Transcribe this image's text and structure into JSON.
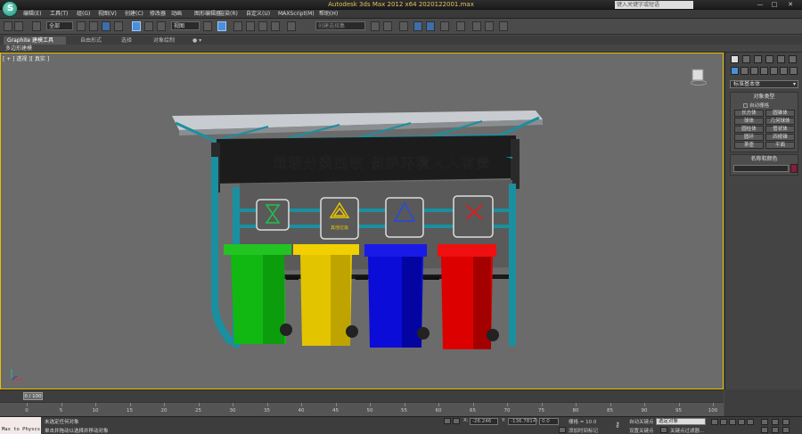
{
  "window": {
    "title": "Autodesk 3ds Max  2012 x64      20201220​01.max",
    "search_placeholder": "键入关键字或短语",
    "controls": [
      "—",
      "□",
      "✕"
    ]
  },
  "menu": [
    "编辑(E)",
    "工具(T)",
    "组(G)",
    "视图(V)",
    "创建(C)",
    "修改器",
    "动画",
    "图形编辑器",
    "渲染(R)",
    "自定义(U)",
    "MAXScript(M)",
    "帮助(H)"
  ],
  "toolbar": {
    "selection_filter": "全部",
    "reference_coord": "视图",
    "named_selection": "创建选择集"
  },
  "ribbon": {
    "tabs": [
      "Graphite 建模工具",
      "自由形式",
      "选择",
      "对象绘制"
    ],
    "active_tab": "Graphite 建模工具",
    "sub_label": "多边形建模"
  },
  "viewport": {
    "label": "[ + ] 透视 ][ 真实 ]",
    "scene": {
      "shelter_text": "垃圾分类回收  保护环境人人有责",
      "signs": [
        {
          "name": "hazardous",
          "color": "#22c24a",
          "caption": ""
        },
        {
          "name": "other",
          "color": "#e8c500",
          "caption": "其他垃圾"
        },
        {
          "name": "recyclable",
          "color": "#2a4bd6",
          "caption": ""
        },
        {
          "name": "kitchen",
          "color": "#d42020",
          "caption": ""
        }
      ],
      "bins": [
        {
          "name": "green-bin",
          "color": "#1ed01e"
        },
        {
          "name": "yellow-bin",
          "color": "#e6c800"
        },
        {
          "name": "blue-bin",
          "color": "#1010e0"
        },
        {
          "name": "red-bin",
          "color": "#e00000"
        }
      ]
    }
  },
  "command_panel": {
    "dropdown": "标准基本体",
    "object_type_title": "对象类型",
    "autogrid": "自动栅格",
    "buttons": [
      "长方体",
      "圆锥体",
      "球体",
      "几何球体",
      "圆柱体",
      "管状体",
      "圆环",
      "四棱锥",
      "茶壶",
      "平面"
    ],
    "name_color_title": "名称和颜色",
    "swatch_color": "#8b1c3a"
  },
  "timeline": {
    "frame_display": "0 / 100",
    "ticks": [
      "0",
      "5",
      "10",
      "15",
      "20",
      "25",
      "30",
      "35",
      "40",
      "45",
      "50",
      "55",
      "60",
      "65",
      "70",
      "75",
      "80",
      "85",
      "90",
      "95",
      "100"
    ]
  },
  "status": {
    "maxscript": "Max to Physcs",
    "line1": "未选定任何对象",
    "line2": "单击并拖动以选择并移动对象",
    "x_label": "X:",
    "x_value": "-26.246",
    "y_label": "Y:",
    "y_value": "-136.781",
    "z_label": "Z:",
    "z_value": "0.0",
    "grid": "栅格 = 10.0",
    "add_time_tag": "添加时间标记",
    "auto_key": "自动关键点",
    "set_key": "设置关键点",
    "key_mode": "选定对象",
    "key_filters": "关键点过滤器..."
  }
}
